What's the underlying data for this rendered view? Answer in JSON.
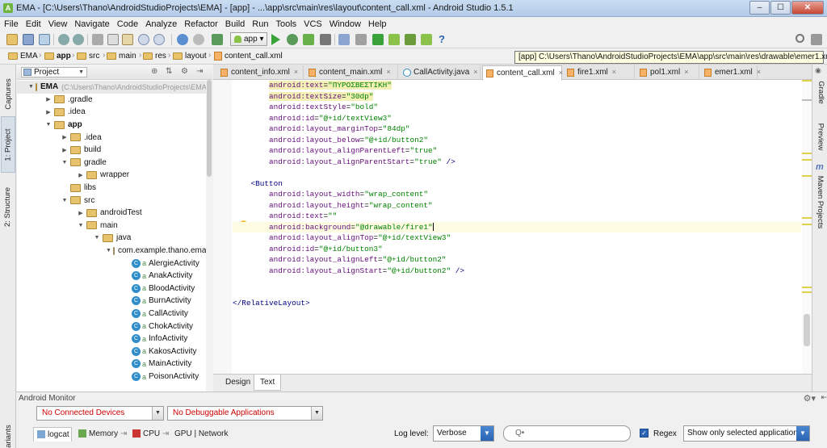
{
  "window": {
    "title": "EMA - [C:\\Users\\Thano\\AndroidStudioProjects\\EMA] - [app] - ...\\app\\src\\main\\res\\layout\\content_call.xml - Android Studio 1.5.1",
    "minimize": "–",
    "maximize": "☐",
    "close": "✕"
  },
  "menu": [
    "File",
    "Edit",
    "View",
    "Navigate",
    "Code",
    "Analyze",
    "Refactor",
    "Build",
    "Run",
    "Tools",
    "VCS",
    "Window",
    "Help"
  ],
  "toolbar": {
    "run_config": "app"
  },
  "breadcrumbs": [
    "EMA",
    "app",
    "src",
    "main",
    "res",
    "layout",
    "content_call.xml"
  ],
  "tooltip": "[app] C:\\Users\\Thano\\AndroidStudioProjects\\EMA\\app\\src\\main\\res\\drawable\\emer1.xml",
  "left_tool_windows": [
    "Captures",
    "1: Project",
    "2: Structure"
  ],
  "right_tool_windows": [
    "Gradle",
    "Preview",
    "Maven Projects"
  ],
  "project_panel": {
    "view_mode": "Project",
    "tree": [
      {
        "label": "EMA",
        "note": "(C:\\Users\\Thano\\AndroidStudioProjects\\EMA)",
        "type": "root"
      },
      {
        "label": ".gradle",
        "type": "folder"
      },
      {
        "label": ".idea",
        "type": "folder"
      },
      {
        "label": "app",
        "type": "module"
      },
      {
        "label": ".idea",
        "type": "folder"
      },
      {
        "label": "build",
        "type": "folder"
      },
      {
        "label": "gradle",
        "type": "folder"
      },
      {
        "label": "wrapper",
        "type": "folder"
      },
      {
        "label": "libs",
        "type": "folder"
      },
      {
        "label": "src",
        "type": "folder"
      },
      {
        "label": "androidTest",
        "type": "folder"
      },
      {
        "label": "main",
        "type": "folder"
      },
      {
        "label": "java",
        "type": "folder"
      },
      {
        "label": "com.example.thano.ema",
        "type": "package"
      },
      {
        "label": "AlergieActivity",
        "type": "class"
      },
      {
        "label": "AnakActivity",
        "type": "class"
      },
      {
        "label": "BloodActivity",
        "type": "class"
      },
      {
        "label": "BurnActivity",
        "type": "class"
      },
      {
        "label": "CallActivity",
        "type": "class"
      },
      {
        "label": "ChokActivity",
        "type": "class"
      },
      {
        "label": "InfoActivity",
        "type": "class"
      },
      {
        "label": "KakosActivity",
        "type": "class"
      },
      {
        "label": "MainActivity",
        "type": "class"
      },
      {
        "label": "PoisonActivity",
        "type": "class"
      }
    ]
  },
  "editor": {
    "tabs": [
      {
        "label": "content_info.xml",
        "kind": "xml"
      },
      {
        "label": "content_main.xml",
        "kind": "xml"
      },
      {
        "label": "CallActivity.java",
        "kind": "java"
      },
      {
        "label": "content_call.xml",
        "kind": "xml",
        "active": true
      },
      {
        "label": "fire1.xml",
        "kind": "xml"
      },
      {
        "label": "pol1.xml",
        "kind": "xml"
      },
      {
        "label": "emer1.xml",
        "kind": "xml"
      }
    ],
    "code": [
      {
        "attr": "android:text",
        "val": "\"ΠΥΡΟΣΒΕΣΤΙΚΗ\"",
        "indent": 1,
        "hl": true
      },
      {
        "attr": "android:textSize",
        "val": "\"30dp\"",
        "indent": 1,
        "hl": true
      },
      {
        "attr": "android:textStyle",
        "val": "\"bold\"",
        "indent": 1
      },
      {
        "attr": "android:id",
        "val": "\"@+id/textView3\"",
        "indent": 1
      },
      {
        "attr": "android:layout_marginTop",
        "val": "\"84dp\"",
        "indent": 1
      },
      {
        "attr": "android:layout_below",
        "val": "\"@+id/button2\"",
        "indent": 1
      },
      {
        "attr": "android:layout_alignParentLeft",
        "val": "\"true\"",
        "indent": 1
      },
      {
        "attr": "android:layout_alignParentStart",
        "val": "\"true\"",
        "suffix": " />",
        "indent": 1
      },
      {
        "blank": true
      },
      {
        "tag": "<Button",
        "indent": 0.5
      },
      {
        "attr": "android:layout_width",
        "val": "\"wrap_content\"",
        "indent": 1
      },
      {
        "attr": "android:layout_height",
        "val": "\"wrap_content\"",
        "indent": 1
      },
      {
        "attr": "android:text",
        "val": "\"\"",
        "indent": 1
      },
      {
        "attr": "android:background",
        "val": "\"@drawable/fire1\"",
        "indent": 1,
        "current": true
      },
      {
        "attr": "android:layout_alignTop",
        "val": "\"@+id/textView3\"",
        "indent": 1
      },
      {
        "attr": "android:id",
        "val": "\"@+id/button3\"",
        "indent": 1
      },
      {
        "attr": "android:layout_alignLeft",
        "val": "\"@+id/button2\"",
        "indent": 1
      },
      {
        "attr": "android:layout_alignStart",
        "val": "\"@+id/button2\"",
        "suffix": " />",
        "indent": 1
      },
      {
        "blank": true
      },
      {
        "blank": true
      },
      {
        "tag": "</RelativeLayout>",
        "indent": 0
      }
    ],
    "bottom_tabs": [
      "Design",
      "Text"
    ],
    "active_bottom_tab": "Text"
  },
  "android_monitor": {
    "title": "Android Monitor",
    "device": "No Connected Devices",
    "app": "No Debuggable Applications",
    "tabs": [
      "logcat",
      "Memory",
      "CPU",
      "GPU | Network"
    ],
    "log_level_label": "Log level:",
    "log_level": "Verbose",
    "search_placeholder": "Q•",
    "regex_label": "Regex",
    "regex_checked": true,
    "filter": "Show only selected application"
  }
}
